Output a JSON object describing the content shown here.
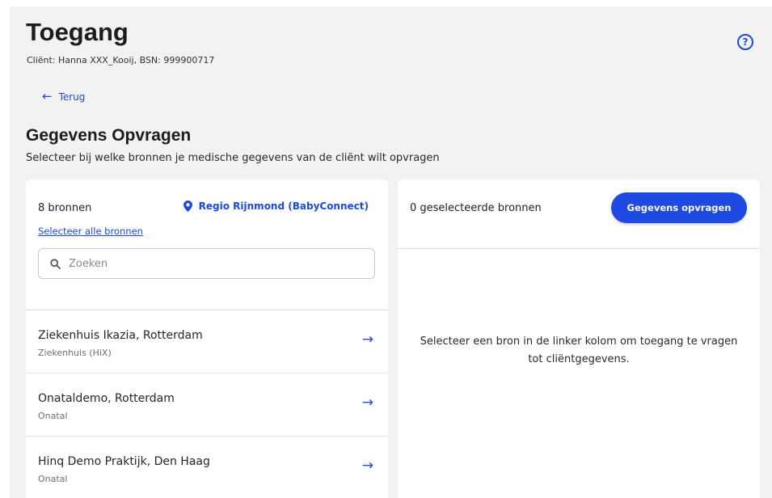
{
  "header": {
    "title": "Toegang",
    "client_info": "Cliënt: Hanna XXX_Kooij, BSN: 999900717",
    "help_icon": "help-circle-icon"
  },
  "nav": {
    "back_label": "Terug",
    "back_icon": "arrow-left-icon"
  },
  "section": {
    "title": "Gegevens Opvragen",
    "subtitle": "Selecteer bij welke bronnen je medische gegevens van de cliënt wilt opvragen"
  },
  "sources_panel": {
    "count_label": "8 bronnen",
    "region_label": "Regio Rijnmond (BabyConnect)",
    "region_icon": "location-pin-icon",
    "select_all_label": "Selecteer alle bronnen",
    "search_placeholder": "Zoeken",
    "items": [
      {
        "name": "Ziekenhuis Ikazia, Rotterdam",
        "type": "Ziekenhuis (HiX)"
      },
      {
        "name": "Onataldemo, Rotterdam",
        "type": "Onatal"
      },
      {
        "name": "Hinq Demo Praktijk, Den Haag",
        "type": "Onatal"
      }
    ]
  },
  "selected_panel": {
    "count_label": "0 geselecteerde bronnen",
    "request_button": "Gegevens opvragen",
    "empty_message": "Selecteer een bron in de linker kolom om toegang te vragen tot cliëntgegevens."
  },
  "colors": {
    "accent": "#1e49e2",
    "background": "#f2f2f2",
    "panel": "#ffffff"
  }
}
